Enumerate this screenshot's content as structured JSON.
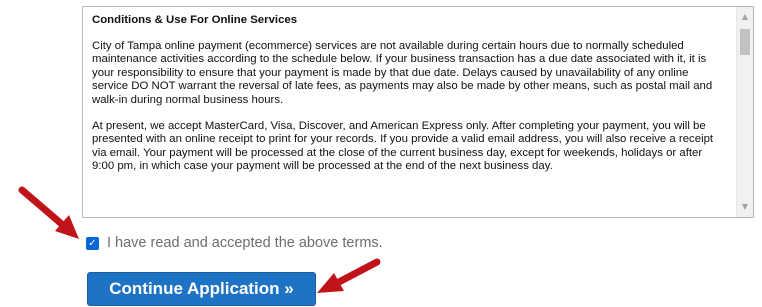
{
  "terms": {
    "title": "Conditions & Use For Online Services",
    "paragraph_1": "City of Tampa online payment (ecommerce) services are not available during certain hours due to normally scheduled maintenance activities according to the schedule below. If your business transaction has a due date associated with it, it is your responsibility to ensure that your payment is made by that due date. Delays caused by unavailability of any online service DO NOT warrant the reversal of late fees, as payments may also be made by other means, such as postal mail and walk-in during normal business hours.",
    "paragraph_2": "At present, we accept MasterCard, Visa, Discover, and American Express only. After completing your payment, you will be presented with an online receipt to print for your records. If you provide a valid email address, you will also receive a receipt via email. Your payment will be processed at the close of the current business day, except for weekends, holidays or after 9:00 pm, in which case your payment will be processed at the end of the next business day."
  },
  "agreement": {
    "checked": true,
    "label": "I have read and accepted the above terms."
  },
  "continue_button": {
    "label": "Continue Application »"
  },
  "annotations": {
    "arrow_color": "#c0131a"
  },
  "colors": {
    "button_bg": "#1e73c4",
    "checkbox_bg": "#0a68d6",
    "label_text": "#6d6d6d"
  },
  "icons": {
    "checkbox": "checkmark-icon",
    "scroll_up": "scroll-up-arrow-icon",
    "scroll_down": "scroll-down-arrow-icon",
    "annotation": "red-pointer-arrow-icon"
  }
}
